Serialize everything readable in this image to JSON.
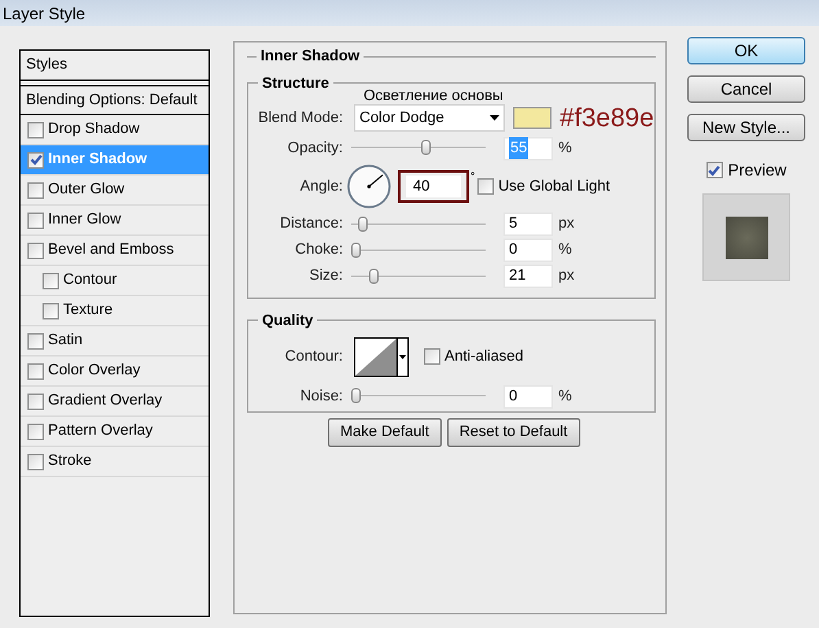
{
  "window": {
    "title": "Layer Style"
  },
  "styles_list": {
    "header": "Styles",
    "items": [
      {
        "label": "Blending Options: Default",
        "kind": "plain",
        "selected": false
      },
      {
        "label": "Drop Shadow",
        "kind": "check",
        "checked": false,
        "selected": false
      },
      {
        "label": "Inner Shadow",
        "kind": "check",
        "checked": true,
        "selected": true
      },
      {
        "label": "Outer Glow",
        "kind": "check",
        "checked": false,
        "selected": false
      },
      {
        "label": "Inner Glow",
        "kind": "check",
        "checked": false,
        "selected": false
      },
      {
        "label": "Bevel and Emboss",
        "kind": "check",
        "checked": false,
        "selected": false,
        "children": [
          {
            "label": "Contour",
            "kind": "check",
            "checked": false,
            "selected": false
          },
          {
            "label": "Texture",
            "kind": "check",
            "checked": false,
            "selected": false
          }
        ]
      },
      {
        "label": "Satin",
        "kind": "check",
        "checked": false,
        "selected": false
      },
      {
        "label": "Color Overlay",
        "kind": "check",
        "checked": false,
        "selected": false
      },
      {
        "label": "Gradient Overlay",
        "kind": "check",
        "checked": false,
        "selected": false
      },
      {
        "label": "Pattern Overlay",
        "kind": "check",
        "checked": false,
        "selected": false
      },
      {
        "label": "Stroke",
        "kind": "check",
        "checked": false,
        "selected": false
      }
    ]
  },
  "inner_shadow": {
    "title": "Inner Shadow",
    "structure": {
      "title": "Structure",
      "annotation": "Осветление основы",
      "blend_mode": {
        "label": "Blend Mode:",
        "value": "Color Dodge",
        "color": "#f3e89e",
        "color_note": "#f3e89e"
      },
      "opacity": {
        "label": "Opacity:",
        "level": 0.55,
        "value": "55",
        "unit": "%",
        "text_selected": true
      },
      "angle": {
        "label": "Angle:",
        "value": "40",
        "unit": "°",
        "circled": true,
        "global_light": {
          "label": "Use Global Light",
          "checked": false
        }
      },
      "sliders": [
        {
          "label": "Distance:",
          "level": 0.05,
          "value": "5",
          "unit": "px"
        },
        {
          "label": "Choke:",
          "level": 0.0,
          "value": "0",
          "unit": "%"
        },
        {
          "label": "Size:",
          "level": 0.14,
          "value": "21",
          "unit": "px"
        }
      ]
    },
    "quality": {
      "title": "Quality",
      "contour_label": "Contour:",
      "anti_aliased": {
        "label": "Anti-aliased",
        "checked": false
      },
      "noise": {
        "label": "Noise:",
        "level": 0.0,
        "value": "0",
        "unit": "%"
      }
    },
    "buttons": [
      "Make Default",
      "Reset to Default"
    ]
  },
  "actions": [
    {
      "label": "OK",
      "default": true
    },
    {
      "label": "Cancel",
      "default": false
    },
    {
      "label": "New Style...",
      "default": false
    }
  ],
  "preview": {
    "label": "Preview",
    "checked": true
  }
}
